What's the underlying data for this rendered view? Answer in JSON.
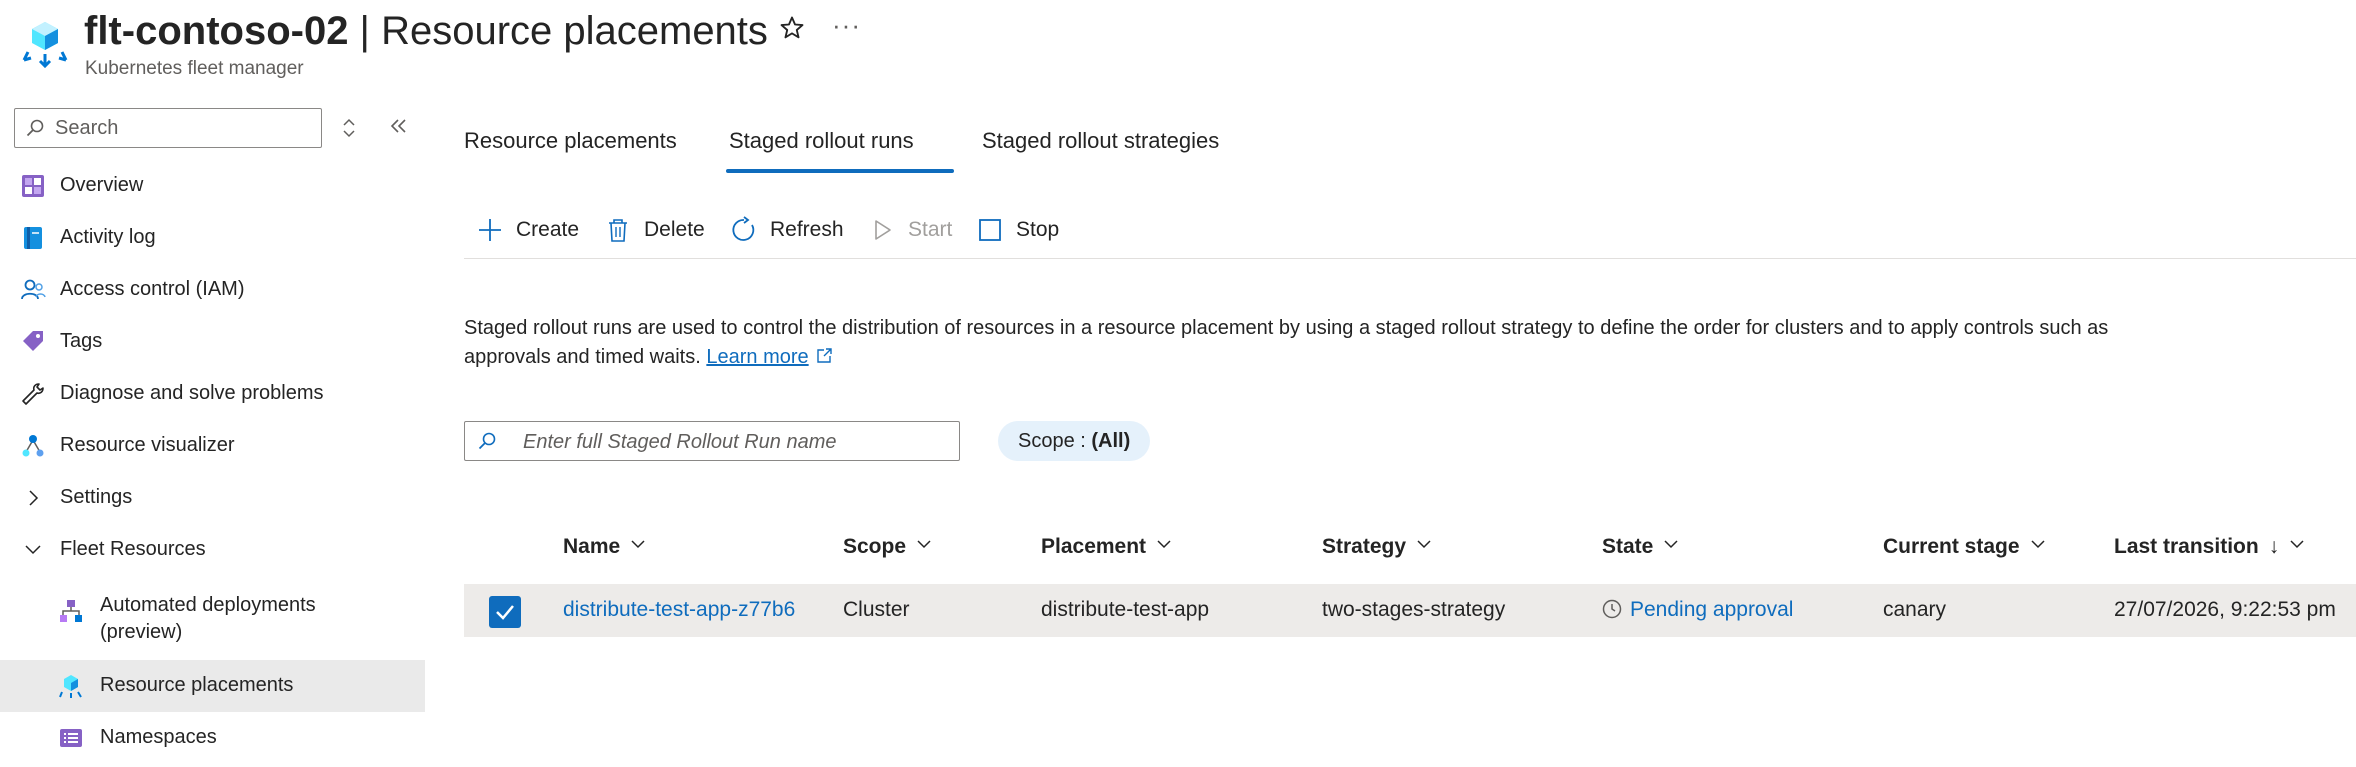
{
  "header": {
    "resource_name": "flt-contoso-02",
    "separator": " | ",
    "page_name": "Resource placements",
    "subtitle": "Kubernetes fleet manager",
    "star_icon": "star-icon",
    "more_label": "···"
  },
  "sidebar": {
    "search_placeholder": "Search",
    "items": [
      {
        "label": "Overview",
        "icon": "overview-icon"
      },
      {
        "label": "Activity log",
        "icon": "activity-log-icon"
      },
      {
        "label": "Access control (IAM)",
        "icon": "access-control-icon"
      },
      {
        "label": "Tags",
        "icon": "tag-icon"
      },
      {
        "label": "Diagnose and solve problems",
        "icon": "wrench-icon"
      },
      {
        "label": "Resource visualizer",
        "icon": "resource-visualizer-icon"
      },
      {
        "label": "Settings",
        "icon": "chevron-right-icon"
      },
      {
        "label": "Fleet Resources",
        "icon": "chevron-down-icon"
      },
      {
        "label_line1": "Automated deployments",
        "label_line2": "(preview)",
        "icon": "automated-deployments-icon"
      },
      {
        "label": "Resource placements",
        "icon": "resource-placements-icon",
        "selected": true
      },
      {
        "label": "Namespaces",
        "icon": "namespaces-icon"
      }
    ]
  },
  "tabs": [
    {
      "label": "Resource placements"
    },
    {
      "label": "Staged rollout runs",
      "active": true
    },
    {
      "label": "Staged rollout strategies"
    }
  ],
  "toolbar": {
    "create": "Create",
    "delete": "Delete",
    "refresh": "Refresh",
    "start": "Start",
    "stop": "Stop"
  },
  "description": {
    "text": "Staged rollout runs are used to control the distribution of resources in a resource placement by using a staged rollout strategy to define the order for clusters and to apply controls such as approvals and timed waits.",
    "link": "Learn more"
  },
  "filter": {
    "placeholder": "Enter full Staged Rollout Run name",
    "scope_label": "Scope : ",
    "scope_value": "(All)"
  },
  "table": {
    "columns": [
      "Name",
      "Scope",
      "Placement",
      "Strategy",
      "State",
      "Current stage",
      "Last transition"
    ],
    "sort_indicator": "↓",
    "rows": [
      {
        "checked": true,
        "name": "distribute-test-app-z77b6",
        "scope": "Cluster",
        "placement": "distribute-test-app",
        "strategy": "two-stages-strategy",
        "state": "Pending approval",
        "current_stage": "canary",
        "last_transition": "27/07/2026, 9:22:53 pm"
      }
    ]
  },
  "colors": {
    "accent": "#0f6cbd",
    "selected_bg": "#eaeaea",
    "row_bg": "#edebe9",
    "pill_bg": "#e5f1fb"
  }
}
